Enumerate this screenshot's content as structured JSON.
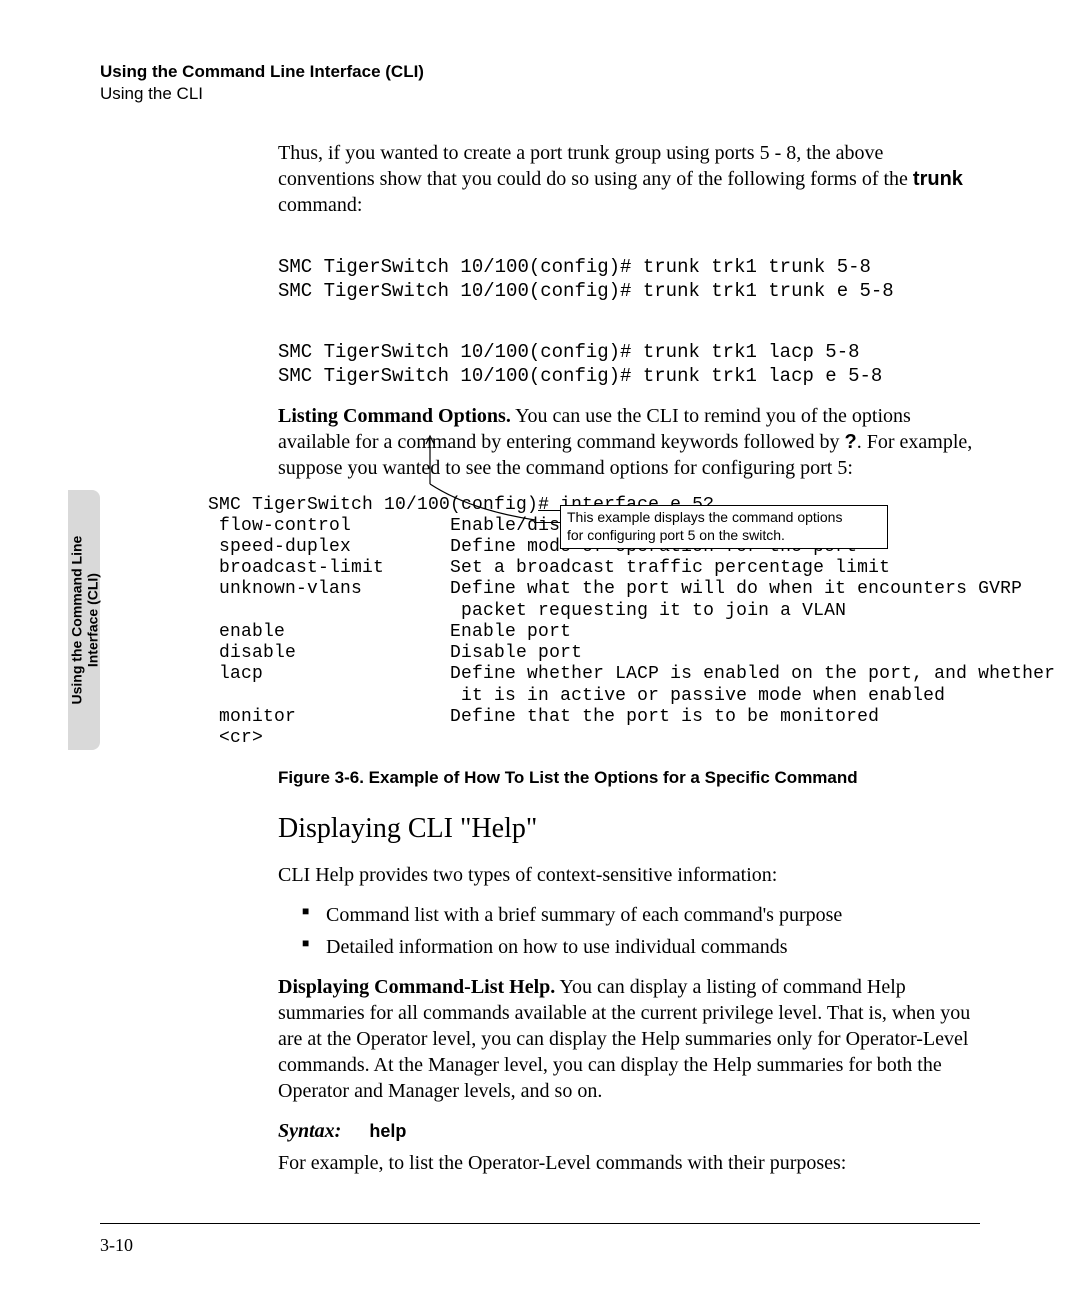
{
  "header": {
    "title": "Using the Command Line Interface (CLI)",
    "subtitle": "Using the CLI"
  },
  "sidetab": {
    "line1": "Using the Command Line",
    "line2": "Interface (CLI)"
  },
  "intro": {
    "p1a": "Thus, if you wanted to create a port trunk group using ports 5 - 8, the above conventions show that you could do so using any of the following forms of the ",
    "p1b": "trunk",
    "p1c": " command:"
  },
  "cmds": {
    "c1": "SMC TigerSwitch 10/100(config)# trunk trk1 trunk 5-8",
    "c2": "SMC TigerSwitch 10/100(config)# trunk trk1 trunk e 5-8",
    "c3": "SMC TigerSwitch 10/100(config)# trunk trk1 lacp 5-8",
    "c4": "SMC TigerSwitch 10/100(config)# trunk trk1 lacp e 5-8"
  },
  "listing": {
    "lead": "Listing Command Options.",
    "body": "  You can use the CLI to remind you of the options available for a command by entering command keywords followed by ",
    "qmark": "?",
    "rest": ". For example, suppose you wanted to see the command options for configuring port 5:"
  },
  "term": {
    "l0a": "SMC TigerSwitch 10/100(config)",
    "l0b": "# interface e 5?",
    "r1k": " flow-control",
    "r1v": "Enable/disable flow control on the port",
    "r2k": " speed-duplex",
    "r2v": "Define mode of operation for the port",
    "r3k": " broadcast-limit",
    "r3v": "Set a broadcast traffic percentage limit",
    "r4k": " unknown-vlans",
    "r4v": "Define what the port will do when it encounters GVRP",
    "r4v2": "packet requesting it to join a VLAN",
    "r5k": " enable",
    "r5v": "Enable port",
    "r6k": " disable",
    "r6v": "Disable port",
    "r7k": " lacp",
    "r7v": "Define whether LACP is enabled on the port, and whether",
    "r7v2": "it is in active or passive mode when enabled",
    "r8k": " monitor",
    "r8v": "Define that the port is to be monitored",
    "r9k": " <cr>"
  },
  "callout": {
    "line1": "This example displays the command options",
    "line2": "for configuring port 5 on the switch."
  },
  "figcap": "Figure 3-6.   Example of How To List the Options for a Specific Command",
  "help": {
    "heading": "Displaying CLI \"Help\"",
    "p1": "CLI Help provides two types of context-sensitive information:",
    "b1": "Command list with a brief summary of each command's purpose",
    "b2": "Detailed information on how to use individual commands",
    "p2lead": "Displaying Command-List Help.",
    "p2body": "  You can display a listing of command Help summaries for all commands available at the current privilege level. That is, when you are at the Operator level, you can display the Help summaries only for Operator-Level commands. At the Manager level, you can display the Help summaries for both the Operator  and Manager levels, and so on.",
    "syntax_label": "Syntax:",
    "syntax_value": "help",
    "p3": "For example, to list the Operator-Level commands with their purposes:"
  },
  "pagenum": "3-10"
}
